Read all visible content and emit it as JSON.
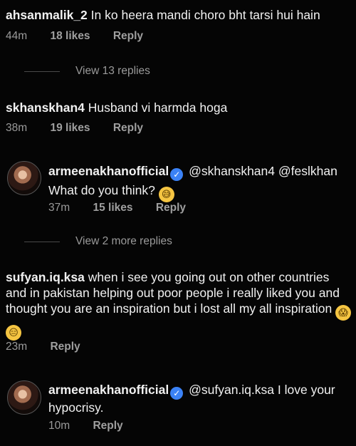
{
  "comments": [
    {
      "username": "ahsanmalik_2",
      "text": "In ko heera mandi choro bht tarsi hui hain",
      "time": "44m",
      "likes": "18 likes",
      "reply": "Reply",
      "view_replies": "View 13 replies"
    },
    {
      "username": "skhanskhan4",
      "text": "Husband vi harmda hoga",
      "time": "38m",
      "likes": "19 likes",
      "reply": "Reply",
      "replies": [
        {
          "username": "armeenakhanofficial",
          "mention": "@skhanskhan4 @feslkhan",
          "text": "What do you think?",
          "emoji": "😅",
          "time": "37m",
          "likes": "15 likes",
          "reply": "Reply"
        }
      ],
      "view_replies": "View 2 more replies"
    },
    {
      "username": "sufyan.iq.ksa",
      "text": "when i see you going out on other countries and in pakistan helping out poor people i really liked you and thought you are an inspiration but i lost all my all inspiration",
      "emojis": [
        "😱",
        "😑"
      ],
      "time": "23m",
      "reply": "Reply",
      "replies": [
        {
          "username": "armeenakhanofficial",
          "mention": "@sufyan.iq.ksa",
          "text": "I love your hypocrisy.",
          "time": "10m",
          "reply": "Reply"
        }
      ]
    }
  ],
  "icons": {
    "verified": "verified-badge-icon",
    "accent": "#3b82f6"
  }
}
